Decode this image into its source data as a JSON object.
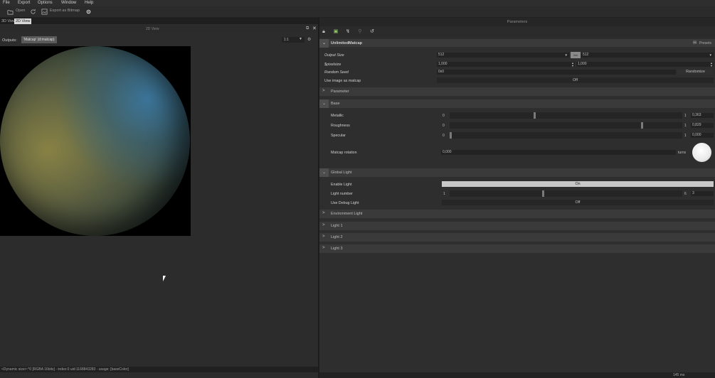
{
  "menu": [
    "File",
    "Export",
    "Options",
    "Window",
    "Help"
  ],
  "toolbar": {
    "open": "Open",
    "export_bitmap": "Export as Bitmap"
  },
  "left_panel": {
    "tabs": [
      "3D View",
      "2D View"
    ],
    "view_title": "2D View",
    "outputs_label": "Outputs:",
    "outputs_value": "'Matcap' (d:matcap)",
    "zoom": "1:1",
    "status": "<Dynamic size>:^0 [RGBA 16bits] - index:0 uid:1168843283 - usage: [baseColor]"
  },
  "right_panel": {
    "title": "Parameters",
    "graph_name": "UnlimitedMatcap",
    "presets_label": "Presets",
    "output_size_label": "Output Size",
    "output_size_w": "512",
    "output_size_link": "link",
    "output_size_h": "512",
    "pixelsize_label": "$pixelsize",
    "pixelsize_x": "1,000",
    "pixelsize_y": "1,000",
    "random_seed_label": "Random Seed",
    "random_seed_value": "0x0",
    "randomize_label": "Randomize",
    "use_image_label": "Use image as matcap",
    "use_image_value": "Off",
    "sections": {
      "parameter": "Parameter",
      "base": "Base",
      "global_light": "Global Light",
      "environment_light": "Environment Light",
      "light1": "Light 1",
      "light2": "Light 2",
      "light3": "Light 3"
    },
    "metallic": {
      "label": "Metallic",
      "min": "0",
      "max": "1",
      "value": "0,363",
      "fraction": 0.363
    },
    "roughness": {
      "label": "Roughness",
      "min": "0",
      "max": "1",
      "value": "0,829",
      "fraction": 0.829
    },
    "specular": {
      "label": "Specular",
      "min": "0",
      "max": "1",
      "value": "0,000",
      "fraction": 0.0
    },
    "matcap_rotation": {
      "label": "Matcap rotation",
      "value": "0,000",
      "unit": "turns"
    },
    "enable_light": {
      "label": "Enable Light",
      "value": "On"
    },
    "light_number": {
      "label": "Light number",
      "min": "1",
      "max": "6",
      "value": "3",
      "fraction": 0.4
    },
    "debug_light": {
      "label": "Use Debug Light",
      "value": "Off"
    }
  },
  "footer": {
    "time": "145 ms"
  },
  "colors": {
    "bg": "#2a2a2a",
    "section": "#3a3a3a",
    "on_button": "#c8c8c8"
  }
}
